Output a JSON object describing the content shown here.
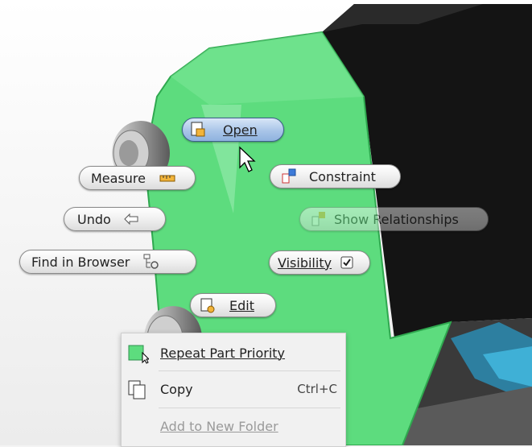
{
  "marking_menu": {
    "open": {
      "label": "Open",
      "icon": "open-document-icon"
    },
    "measure": {
      "label": "Measure",
      "icon": "ruler-icon"
    },
    "constraint": {
      "label": "Constraint",
      "icon": "constraint-icon"
    },
    "undo": {
      "label": "Undo",
      "icon": "undo-arrow-icon"
    },
    "show_relationships": {
      "label": "Show Relationships",
      "icon": "relationships-icon"
    },
    "find_in_browser": {
      "label": "Find in Browser",
      "icon": "browser-tree-icon"
    },
    "visibility": {
      "label": "Visibility",
      "icon": "checkbox-checked-icon"
    },
    "edit": {
      "label": "Edit",
      "icon": "edit-icon"
    }
  },
  "context_menu": {
    "items": [
      {
        "label": "Repeat Part Priority",
        "shortcut": "",
        "icon": "part-priority-icon"
      },
      {
        "label": "Copy",
        "shortcut": "Ctrl+C",
        "icon": "copy-icon"
      },
      {
        "label": "Add to New Folder",
        "shortcut": "",
        "icon": ""
      }
    ]
  },
  "colors": {
    "selected_face": "#5ddc7e",
    "model_dark": "#151515",
    "menu_highlight": "#a9c5e8",
    "menu_background": "#f1f1f1"
  }
}
